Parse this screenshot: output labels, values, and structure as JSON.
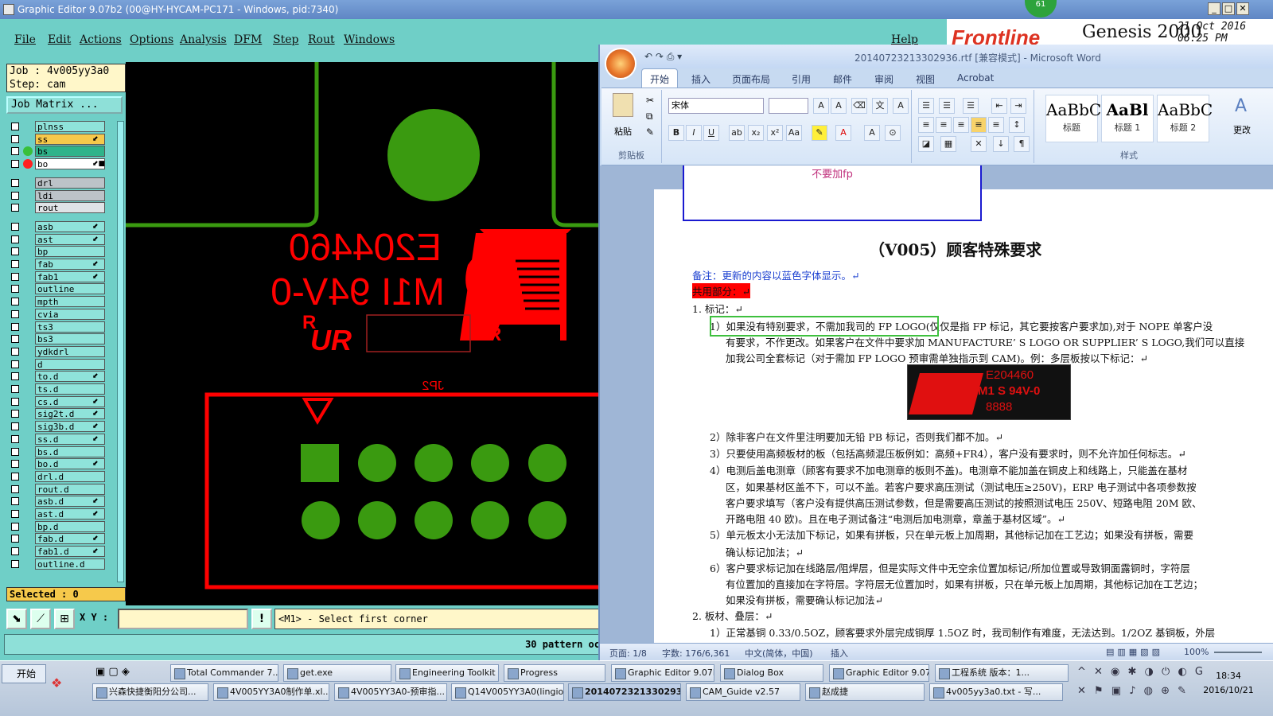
{
  "genesis": {
    "title": "Graphic Editor 9.07b2 (00@HY-HYCAM-PC171 - Windows, pid:7340)",
    "menu": [
      "File",
      "Edit",
      "Actions",
      "Options",
      "Analysis",
      "DFM",
      "Step",
      "Rout",
      "Windows"
    ],
    "help": "Help",
    "logo": "Frontline",
    "product": "Genesis 2000",
    "date": "21 Oct 2016",
    "time": "06:25 PM",
    "badge": "61",
    "job": "Job : 4v005yy3a0",
    "step": "Step: cam",
    "job_matrix": "Job Matrix ...",
    "layers": [
      {
        "name": "plnss",
        "color": "#8fe3da",
        "dot": "",
        "mark": ""
      },
      {
        "name": "ss",
        "color": "#f6c94b",
        "dot": "",
        "mark": "⬋"
      },
      {
        "name": "bs",
        "color": "#2fb38a",
        "dot": "#38c03a",
        "mark": ""
      },
      {
        "name": "bo",
        "color": "#ffffff",
        "dot": "#ff2020",
        "mark": "⬋■"
      },
      {
        "name": "drl",
        "color": "#bcc3c8",
        "dot": "",
        "mark": ""
      },
      {
        "name": "ldi",
        "color": "#bcc3c8",
        "dot": "",
        "mark": ""
      },
      {
        "name": "rout",
        "color": "#dfe3e6",
        "dot": "",
        "mark": ""
      },
      {
        "name": "asb",
        "color": "#8fe3da",
        "dot": "",
        "mark": "⬋"
      },
      {
        "name": "ast",
        "color": "#8fe3da",
        "dot": "",
        "mark": "⬋"
      },
      {
        "name": "bp",
        "color": "#8fe3da",
        "dot": "",
        "mark": ""
      },
      {
        "name": "fab",
        "color": "#8fe3da",
        "dot": "",
        "mark": "⬋"
      },
      {
        "name": "fab1",
        "color": "#8fe3da",
        "dot": "",
        "mark": "⬋"
      },
      {
        "name": "outline",
        "color": "#8fe3da",
        "dot": "",
        "mark": ""
      },
      {
        "name": "mpth",
        "color": "#8fe3da",
        "dot": "",
        "mark": ""
      },
      {
        "name": "cvia",
        "color": "#8fe3da",
        "dot": "",
        "mark": ""
      },
      {
        "name": "ts3",
        "color": "#8fe3da",
        "dot": "",
        "mark": ""
      },
      {
        "name": "bs3",
        "color": "#8fe3da",
        "dot": "",
        "mark": ""
      },
      {
        "name": "ydkdrl",
        "color": "#8fe3da",
        "dot": "",
        "mark": ""
      },
      {
        "name": "d",
        "color": "#8fe3da",
        "dot": "",
        "mark": ""
      },
      {
        "name": "to.d",
        "color": "#8fe3da",
        "dot": "",
        "mark": "⬋"
      },
      {
        "name": "ts.d",
        "color": "#8fe3da",
        "dot": "",
        "mark": ""
      },
      {
        "name": "cs.d",
        "color": "#8fe3da",
        "dot": "",
        "mark": "⬋"
      },
      {
        "name": "sig2t.d",
        "color": "#8fe3da",
        "dot": "",
        "mark": "⬋"
      },
      {
        "name": "sig3b.d",
        "color": "#8fe3da",
        "dot": "",
        "mark": "⬋"
      },
      {
        "name": "ss.d",
        "color": "#8fe3da",
        "dot": "",
        "mark": "⬋"
      },
      {
        "name": "bs.d",
        "color": "#8fe3da",
        "dot": "",
        "mark": ""
      },
      {
        "name": "bo.d",
        "color": "#8fe3da",
        "dot": "",
        "mark": "⬋"
      },
      {
        "name": "drl.d",
        "color": "#8fe3da",
        "dot": "",
        "mark": ""
      },
      {
        "name": "rout.d",
        "color": "#8fe3da",
        "dot": "",
        "mark": ""
      },
      {
        "name": "asb.d",
        "color": "#8fe3da",
        "dot": "",
        "mark": "⬋"
      },
      {
        "name": "ast.d",
        "color": "#8fe3da",
        "dot": "",
        "mark": "⬋"
      },
      {
        "name": "bp.d",
        "color": "#8fe3da",
        "dot": "",
        "mark": ""
      },
      {
        "name": "fab.d",
        "color": "#8fe3da",
        "dot": "",
        "mark": "⬋"
      },
      {
        "name": "fab1.d",
        "color": "#8fe3da",
        "dot": "",
        "mark": "⬋"
      },
      {
        "name": "outline.d",
        "color": "#8fe3da",
        "dot": "",
        "mark": ""
      }
    ],
    "selected": "Selected : 0",
    "xy_label": "X Y :",
    "xy_value": "",
    "message": "<M1> - Select first corner",
    "status": "30 pattern oc",
    "canvas": {
      "text1": "E204460",
      "text2": "M1I 94V-0",
      "text3": "JP2",
      "r_mark": "R",
      "ul_mark": "UR",
      "accent_red": "#ff0000",
      "accent_green": "#3a9a10"
    }
  },
  "word": {
    "title": "20140723213302936.rtf [兼容模式] - Microsoft Word",
    "tabs": [
      "开始",
      "插入",
      "页面布局",
      "引用",
      "邮件",
      "审阅",
      "视图",
      "Acrobat"
    ],
    "font_name": "宋体",
    "font_size": "",
    "groups": {
      "clipboard": "剪贴板",
      "styles": "样式"
    },
    "paste": "粘贴",
    "change_style": "更改",
    "styles": [
      {
        "preview": "AaBbC",
        "label": "标题"
      },
      {
        "preview": "AaBl",
        "label": "标题 1"
      },
      {
        "preview": "AaBbC",
        "label": "标题 2"
      }
    ],
    "comment": "不要加fp",
    "doc_title": "（V005）顾客特殊要求",
    "lines": [
      {
        "text": "备注：更新的内容以蓝色字体显示。↵",
        "color": "#1a3fd0",
        "bg": ""
      },
      {
        "text": "共用部分：↵",
        "color": "#111",
        "bg": "#ff0000"
      },
      {
        "text": "1.  标记：↵",
        "color": "#111",
        "bg": ""
      },
      {
        "text": "1）如果没有特别要求，不需加我司的 FP LOGO(仅仅是指 FP 标记，其它要按客户要求加),对于 NOPE 单客户没",
        "color": "#111",
        "bg": ""
      },
      {
        "text": "有要求，不作更改。如果客户在文件中要求加 MANUFACTURE’ S LOGO OR SUPPLIER’ S LOGO,我们可以直接",
        "color": "#111",
        "bg": ""
      },
      {
        "text": "加我公司全套标记（对于需加 FP LOGO 预审需单独指示到 CAM)。例：多层板按以下标记：↵",
        "color": "#111",
        "bg": ""
      },
      {
        "text": "2）除非客户在文件里注明要加无铅 PB 标记，否则我们都不加。↵",
        "color": "#111",
        "bg": ""
      },
      {
        "text": "3）只要使用高频板材的板（包括高频混压板例如：高频+FR4），客户没有要求时，则不允许加任何标志。↵",
        "color": "#111",
        "bg": ""
      },
      {
        "text": "4）电测后盖电测章（顾客有要求不加电测章的板则不盖)。电测章不能加盖在铜皮上和线路上，只能盖在基材",
        "color": "#111",
        "bg": ""
      },
      {
        "text": "区，如果基材区盖不下，可以不盖。若客户要求高压测试（测试电压≥250V)，ERP 电子测试中各项参数按",
        "color": "#111",
        "bg": ""
      },
      {
        "text": "客户要求填写（客户没有提供高压测试参数，但是需要高压测试的按照测试电压 250V、短路电阻 20M 欧、",
        "color": "#111",
        "bg": ""
      },
      {
        "text": "开路电阻 40 欧)。且在电子测试备注“电测后加电测章，章盖于基材区域”。↵",
        "color": "#111",
        "bg": ""
      },
      {
        "text": "5）单元板太小无法加下标记，如果有拼板，只在单元板上加周期，其他标记加在工艺边；如果没有拼板，需要",
        "color": "#111",
        "bg": ""
      },
      {
        "text": "确认标记加法；↵",
        "color": "#111",
        "bg": ""
      },
      {
        "text": "6）客户要求标记加在线路层/阻焊层，但是实际文件中无空余位置加标记/所加位置或导致铜面露铜时，字符层",
        "color": "#111",
        "bg": ""
      },
      {
        "text": "有位置加的直接加在字符层。字符层无位置加时，如果有拼板，只在单元板上加周期，其他标记加在工艺边；",
        "color": "#111",
        "bg": ""
      },
      {
        "text": "如果没有拼板，需要确认标记加法↵",
        "color": "#111",
        "bg": ""
      },
      {
        "text": "2.  板材、叠层：↵",
        "color": "#111",
        "bg": ""
      },
      {
        "text": "1）正常基铜 0.33/0.5OZ，顾客要求外层完成铜厚 1.5OZ 时，我司制作有难度，无法达到。1/2OZ 基铜板，外层",
        "color": "#111",
        "bg": ""
      }
    ],
    "logo_img": {
      "line1": "E204460",
      "line2": "M1 S 94V-0",
      "line3": "8888"
    },
    "status": {
      "page": "页面: 1/8",
      "words": "字数: 176/6,361",
      "lang": "中文(简体，中国)",
      "mode": "插入",
      "zoom": "100%"
    }
  },
  "taskbar": {
    "start": "开始",
    "row1": [
      "Total Commander 7....",
      "get.exe",
      "Engineering Toolkit 9....",
      "Progress",
      "Graphic Editor 9.07b...",
      "Dialog Box",
      "Graphic Editor 9.07b...",
      "工程系统  版本：1..."
    ],
    "row2": [
      "兴森快捷衡阳分公司...",
      "4V005YY3A0制作单.xl...",
      "4V005YY3A0-预审指...",
      "Q14V005YY3A0(lingion...",
      "2014072321330293...",
      "CAM_Guide v2.57",
      "赵成捷",
      "4v005yy3a0.txt - 写..."
    ],
    "time": "18:34",
    "date": "2016/10/21"
  }
}
